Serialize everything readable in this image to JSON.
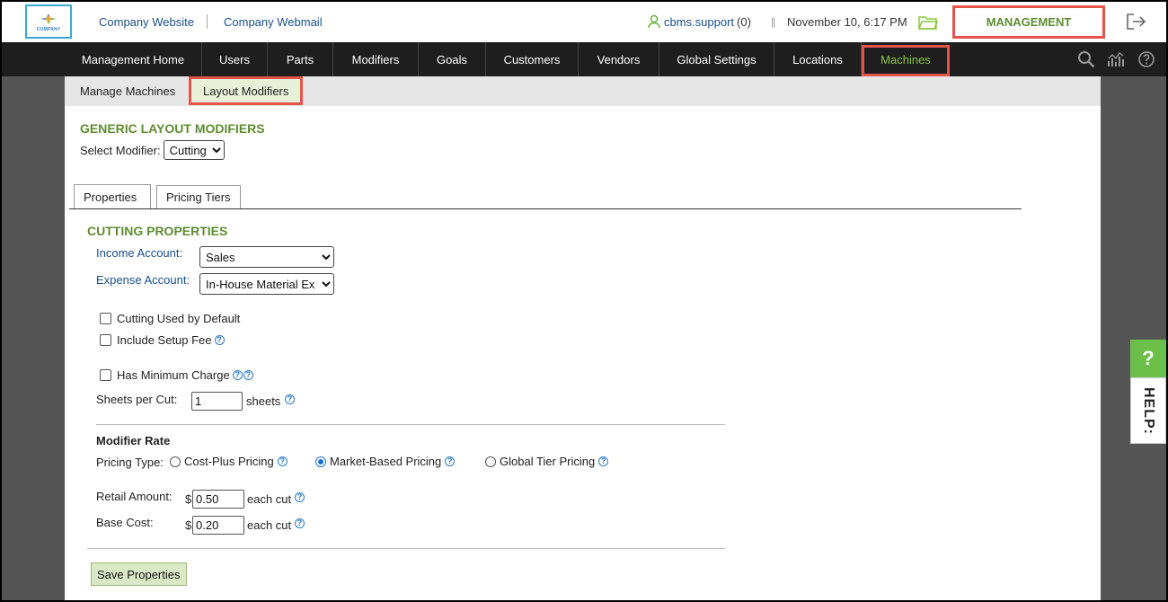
{
  "header": {
    "logo_text": "COMPANY",
    "links": [
      "Company Website",
      "Company Webmail"
    ],
    "user_name": "cbms.support",
    "user_count": "(0)",
    "separator": "||",
    "datetime": "November 10, 6:17 PM",
    "management_label": "MANAGEMENT"
  },
  "main_nav": {
    "items": [
      "Management Home",
      "Users",
      "Parts",
      "Modifiers",
      "Goals",
      "Customers",
      "Vendors",
      "Global Settings",
      "Locations",
      "Machines"
    ],
    "active": "Machines"
  },
  "sub_nav": {
    "items": [
      "Manage Machines",
      "Layout Modifiers"
    ],
    "active": "Layout Modifiers"
  },
  "page": {
    "title": "GENERIC LAYOUT MODIFIERS",
    "select_label": "Select Modifier:",
    "select_value": "Cutting",
    "tabs": [
      "Properties",
      "Pricing Tiers"
    ],
    "active_tab": "Properties"
  },
  "properties": {
    "section_title": "CUTTING PROPERTIES",
    "income_label": "Income Account:",
    "income_value": "Sales",
    "expense_label": "Expense Account:",
    "expense_value": "In-House Material Ex",
    "cutting_default_label": "Cutting Used by Default",
    "cutting_default_checked": false,
    "setup_fee_label": "Include Setup Fee",
    "setup_fee_checked": false,
    "min_charge_label": "Has Minimum Charge",
    "min_charge_checked": false,
    "sheets_label": "Sheets per Cut:",
    "sheets_value": "1",
    "sheets_unit": "sheets"
  },
  "rate": {
    "title": "Modifier Rate",
    "pricing_type_label": "Pricing Type:",
    "options": [
      "Cost-Plus Pricing",
      "Market-Based Pricing",
      "Global Tier Pricing"
    ],
    "selected": "Market-Based Pricing",
    "retail_label": "Retail Amount:",
    "retail_currency": "$",
    "retail_value": "0.50",
    "retail_unit": "each cut",
    "base_label": "Base Cost:",
    "base_currency": "$",
    "base_value": "0.20",
    "base_unit": "each cut"
  },
  "actions": {
    "save_label": "Save Properties"
  },
  "help_tab": {
    "icon": "?",
    "label": "HELP:"
  },
  "colors": {
    "accent_green": "#5e8c31",
    "nav_active": "#8cc63f",
    "highlight_red": "#e5534b",
    "link_blue": "#1a4f8b",
    "nav_bg": "#1e1e1e"
  }
}
